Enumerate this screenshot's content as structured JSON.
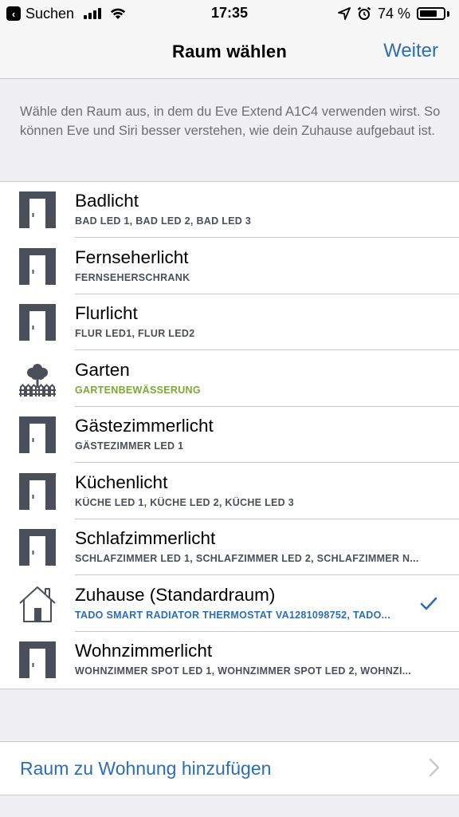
{
  "status_bar": {
    "back_label": "Suchen",
    "time": "17:35",
    "battery_percent": "74 %",
    "battery_level": 0.74
  },
  "nav": {
    "title": "Raum wählen",
    "next_label": "Weiter"
  },
  "description": "Wähle den Raum aus, in dem du Eve Extend A1C4 verwenden wirst. So können Eve und Siri besser verstehen, wie dein Zuhause aufgebaut ist.",
  "rooms": [
    {
      "title": "Badlicht",
      "subtitle": "BAD LED 1, BAD LED 2, BAD LED 3",
      "icon": "door-icon"
    },
    {
      "title": "Fernseherlicht",
      "subtitle": "FERNSEHERSCHRANK",
      "icon": "door-icon"
    },
    {
      "title": "Flurlicht",
      "subtitle": "FLUR LED1, FLUR LED2",
      "icon": "door-icon"
    },
    {
      "title": "Garten",
      "subtitle": "GARTENBEWÄSSERUNG",
      "icon": "garden-icon"
    },
    {
      "title": "Gästezimmerlicht",
      "subtitle": "GÄSTEZIMMER LED 1",
      "icon": "door-icon"
    },
    {
      "title": "Küchenlicht",
      "subtitle": "KÜCHE LED 1, KÜCHE LED 2, KÜCHE LED 3",
      "icon": "door-icon"
    },
    {
      "title": "Schlafzimmerlicht",
      "subtitle": "SCHLAFZIMMER LED 1, SCHLAFZIMMER LED 2, SCHLAFZIMMER N...",
      "icon": "door-icon"
    },
    {
      "title": "Zuhause (Standardraum)",
      "subtitle": "TADO SMART RADIATOR THERMOSTAT VA1281098752, TADO...",
      "icon": "house-icon",
      "selected": true
    },
    {
      "title": "Wohnzimmerlicht",
      "subtitle": "WOHNZIMMER SPOT LED 1, WOHNZIMMER SPOT LED 2, WOHNZI...",
      "icon": "door-icon"
    }
  ],
  "add_room_label": "Raum zu Wohnung hinzufügen",
  "colors": {
    "accent": "#2c6db8",
    "icon_dark": "#4a4f59",
    "garden_green": "#7fa63a",
    "selected_blue": "#2c6db8"
  }
}
